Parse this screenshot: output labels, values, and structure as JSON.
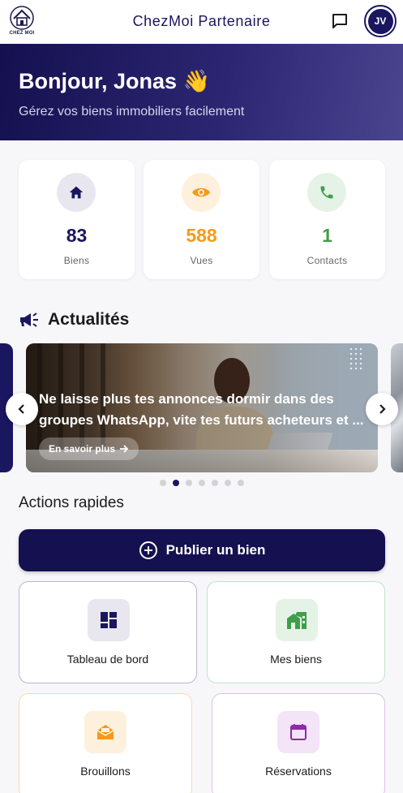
{
  "app": {
    "title": "ChezMoi Partenaire",
    "logo_text": "CHEZ MOI"
  },
  "user": {
    "initials": "JV"
  },
  "hero": {
    "title": "Bonjour, Jonas 👋",
    "subtitle": "Gérez vos biens immobiliers facilement"
  },
  "stats": [
    {
      "value": "83",
      "label": "Biens",
      "color": "#1a1660",
      "bg": "#e8e7f0",
      "icon": "home-icon"
    },
    {
      "value": "588",
      "label": "Vues",
      "color": "#f59a1b",
      "bg": "#fdf0dc",
      "icon": "eye-icon"
    },
    {
      "value": "1",
      "label": "Contacts",
      "color": "#3f9e4b",
      "bg": "#e5f3e6",
      "icon": "phone-icon"
    }
  ],
  "news": {
    "title": "Actualités",
    "slide": {
      "line1": "Ne laisse plus tes annonces dormir dans des",
      "line2": "groupes WhatsApp, vite tes futurs acheteurs et ...",
      "cta": "En savoir plus"
    },
    "dots_count": 7,
    "active_dot": 1
  },
  "quick_actions": {
    "title": "Actions rapides",
    "publish_label": "Publier un bien",
    "tiles": [
      {
        "label": "Tableau de bord",
        "icon": "dashboard-icon",
        "color": "#1a1660",
        "bg": "#e8e7f0",
        "border": "#b9b7d2"
      },
      {
        "label": "Mes biens",
        "icon": "buildings-icon",
        "color": "#3f9e4b",
        "bg": "#e5f3e6",
        "border": "#bfe3c3"
      },
      {
        "label": "Brouillons",
        "icon": "drafts-icon",
        "color": "#f59a1b",
        "bg": "#fdf0dc",
        "border": "#f8dcae"
      },
      {
        "label": "Réservations",
        "icon": "calendar-icon",
        "color": "#8e2aa8",
        "bg": "#f3e4f7",
        "border": "#dcc1e6"
      }
    ]
  },
  "colors": {
    "primary": "#15104f",
    "accent_orange": "#f59a1b",
    "accent_green": "#3f9e4b",
    "accent_purple": "#8e2aa8"
  }
}
